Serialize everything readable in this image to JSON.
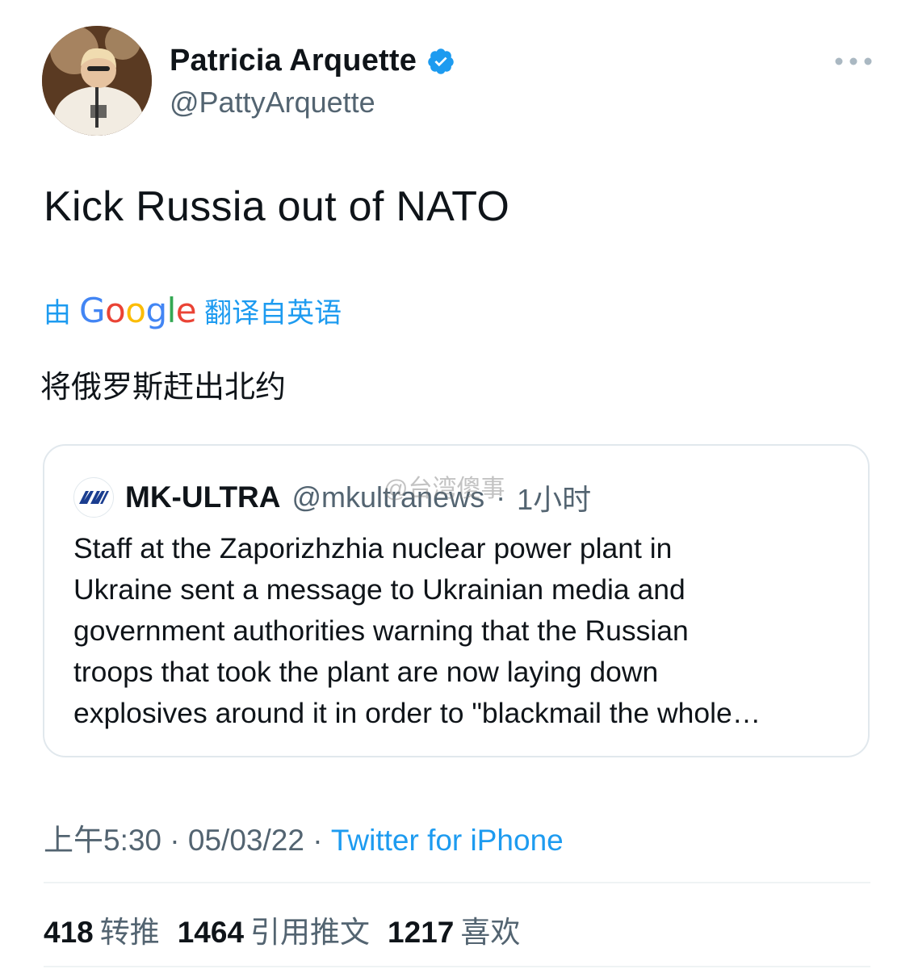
{
  "author": {
    "display_name": "Patricia Arquette",
    "handle": "@PattyArquette"
  },
  "tweet": {
    "text": "Kick Russia out of NATO"
  },
  "translation": {
    "prefix": "由",
    "provider": "Google",
    "suffix": "翻译自英语",
    "text": "将俄罗斯赶出北约"
  },
  "quoted_tweet": {
    "display_name": "MK-ULTRA",
    "handle": "@mkultranews",
    "separator": "·",
    "time": "1小时",
    "lines": [
      "Staff at the Zaporizhzhia nuclear power plant in",
      "Ukraine sent a message to Ukrainian media and",
      "government authorities warning that the Russian",
      "troops that took the plant are now laying down",
      "explosives around it in order to \"blackmail the whole…"
    ]
  },
  "watermark": "@台湾傻事",
  "meta": {
    "time": "上午5:30",
    "sep1": "·",
    "date": "05/03/22",
    "sep2": "·",
    "source": "Twitter for iPhone"
  },
  "stats": {
    "retweets_count": "418",
    "retweets_label": "转推",
    "quotes_count": "1464",
    "quotes_label": "引用推文",
    "likes_count": "1217",
    "likes_label": "喜欢"
  },
  "icons": {
    "verified": "verified-badge-icon",
    "more": "more-options-icon",
    "quote_logo": "mk-ultra-logo-icon"
  },
  "colors": {
    "link_blue": "#1d9bf0",
    "secondary_text": "#536471",
    "primary_text": "#0f1419",
    "border": "#e1e8ed"
  }
}
